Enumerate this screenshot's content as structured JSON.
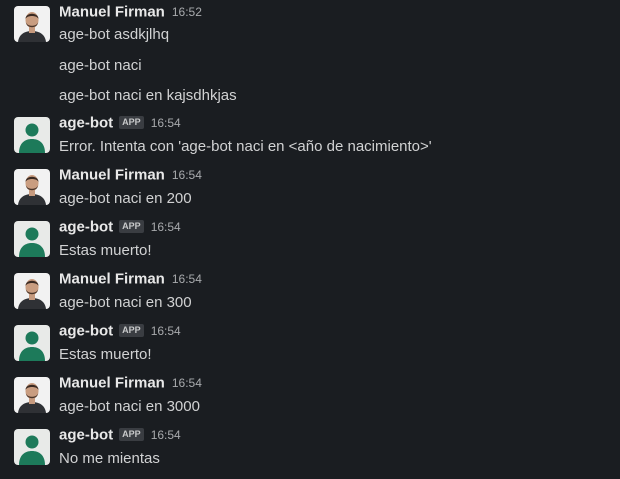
{
  "messages": [
    {
      "sender": "Manuel Firman",
      "avatar": "user-avatar",
      "time": "16:52",
      "lines": [
        "age-bot asdkjlhq",
        "age-bot naci",
        "age-bot naci en kajsdhkjas"
      ]
    },
    {
      "sender": "age-bot",
      "badge": "APP",
      "avatar": "bot-avatar",
      "time": "16:54",
      "lines": [
        "Error. Intenta con 'age-bot naci en <año de nacimiento>'"
      ]
    },
    {
      "sender": "Manuel Firman",
      "avatar": "user-avatar",
      "time": "16:54",
      "lines": [
        "age-bot naci en 200"
      ]
    },
    {
      "sender": "age-bot",
      "badge": "APP",
      "avatar": "bot-avatar",
      "time": "16:54",
      "lines": [
        "Estas muerto!"
      ]
    },
    {
      "sender": "Manuel Firman",
      "avatar": "user-avatar",
      "time": "16:54",
      "lines": [
        "age-bot naci en 300"
      ]
    },
    {
      "sender": "age-bot",
      "badge": "APP",
      "avatar": "bot-avatar",
      "time": "16:54",
      "lines": [
        "Estas muerto!"
      ]
    },
    {
      "sender": "Manuel Firman",
      "avatar": "user-avatar",
      "time": "16:54",
      "lines": [
        "age-bot naci en 3000"
      ]
    },
    {
      "sender": "age-bot",
      "badge": "APP",
      "avatar": "bot-avatar",
      "time": "16:54",
      "lines": [
        "No me mientas"
      ]
    }
  ],
  "colors": {
    "background": "#1a1d21",
    "sender_text": "#e8e8e8",
    "message_text": "#d1d2d3",
    "timestamp": "#a8aaad",
    "bot_avatar_bg": "#e8eae8",
    "bot_avatar_fg": "#1d7a5a"
  }
}
